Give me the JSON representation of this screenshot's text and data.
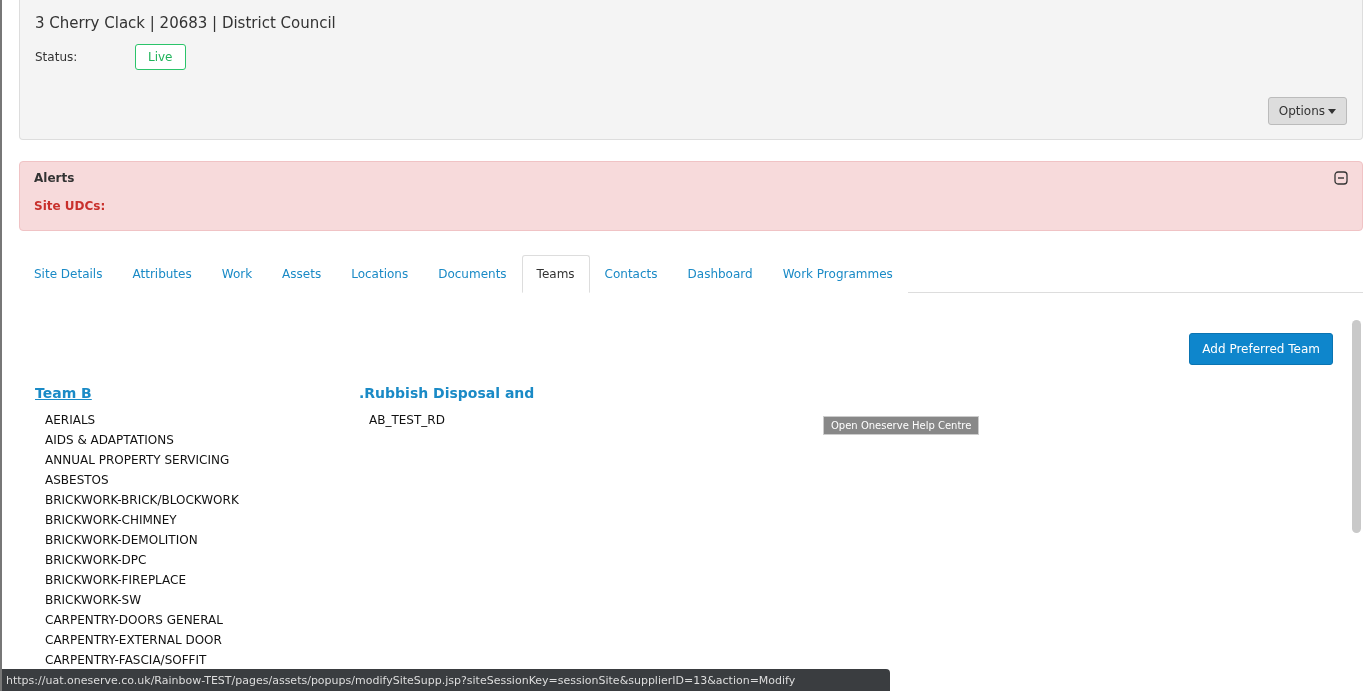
{
  "header": {
    "title": "3 Cherry Clack | 20683 | District Council",
    "status_label": "Status:",
    "status": "Live",
    "options_button": "Options"
  },
  "alerts": {
    "title": "Alerts",
    "expanded": true,
    "site_udcs": "Site UDCs:"
  },
  "tabs": [
    {
      "label": "Site Details",
      "selected": false
    },
    {
      "label": "Attributes",
      "selected": false
    },
    {
      "label": "Work",
      "selected": false
    },
    {
      "label": "Assets",
      "selected": false
    },
    {
      "label": "Locations",
      "selected": false
    },
    {
      "label": "Documents",
      "selected": false
    },
    {
      "label": "Teams",
      "selected": true
    },
    {
      "label": "Contacts",
      "selected": false
    },
    {
      "label": "Dashboard",
      "selected": false
    },
    {
      "label": "Work Programmes",
      "selected": false
    }
  ],
  "add_button": "Add Preferred Team",
  "teams": [
    {
      "name": "Team B",
      "kind": "link",
      "trades": [
        "AERIALS",
        "AIDS & ADAPTATIONS",
        "ANNUAL PROPERTY SERVICING",
        "ASBESTOS",
        "BRICKWORK-BRICK/BLOCKWORK",
        "BRICKWORK-CHIMNEY",
        "BRICKWORK-DEMOLITION",
        "BRICKWORK-DPC",
        "BRICKWORK-FIREPLACE",
        "BRICKWORK-SW",
        "CARPENTRY-DOORS GENERAL",
        "CARPENTRY-EXTERNAL DOOR",
        "CARPENTRY-FASCIA/SOFFIT"
      ]
    },
    {
      "name": ".Rubbish Disposal and",
      "kind": "heading",
      "trades": [
        "AB_TEST_RD"
      ]
    }
  ],
  "tooltip": "Open Oneserve Help Centre",
  "status_bar": "https://uat.oneserve.co.uk/Rainbow-TEST/pages/assets/popups/modifySiteSupp.jsp?siteSessionKey=sessionSite&supplierID=13&action=Modify"
}
